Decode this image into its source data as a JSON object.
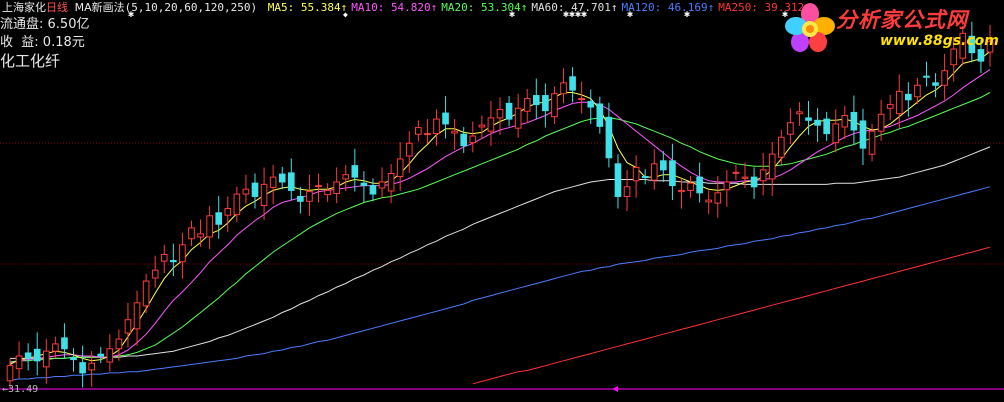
{
  "header": {
    "stock_name": "上海家化",
    "period": "日线",
    "indicator": "MA新画法",
    "params": "(5,10,20,60,120,250)",
    "ma": [
      {
        "label": "MA5:",
        "value": "55.384",
        "arrow": "↑",
        "color": "#ffff55"
      },
      {
        "label": "MA10:",
        "value": "54.820",
        "arrow": "↑",
        "color": "#ff55ff"
      },
      {
        "label": "MA20:",
        "value": "53.304",
        "arrow": "↑",
        "color": "#55ff55"
      },
      {
        "label": "MA60:",
        "value": "47.701",
        "arrow": "↑",
        "color": "#e0e0e0"
      },
      {
        "label": "MA120:",
        "value": "46.169",
        "arrow": "↑",
        "color": "#4a7cff"
      },
      {
        "label": "MA250:",
        "value": "39.312",
        "arrow": "↑",
        "color": "#ff3333"
      }
    ]
  },
  "info": {
    "float_label": "流通盘:",
    "float_value": "6.50亿",
    "eps_label": "收  益:",
    "eps_value": "0.18元",
    "industry": "化工化纤"
  },
  "logo": {
    "text": "分析家公式网",
    "url": "www.88gs.com"
  },
  "colors": {
    "up": "#ff3b3b",
    "down": "#3fe0e8",
    "ma5": "#ffff55",
    "ma10": "#ff55ff",
    "ma20": "#55ff55",
    "ma60": "#e0e0e0",
    "ma120": "#4a7cff",
    "ma250": "#ff3333",
    "grid": "#8b0000",
    "bottom_axis": "#ff00ff"
  },
  "chart_data": {
    "type": "candlestick",
    "low_label": "31.49",
    "ylim": [
      30.8,
      61
    ],
    "close": [
      32.4,
      33.2,
      33.0,
      32.8,
      33.6,
      34.2,
      33.8,
      32.9,
      31.8,
      32.6,
      33.2,
      33.8,
      34.6,
      36.2,
      37.6,
      39.4,
      40.3,
      41.6,
      41.0,
      42.4,
      43.8,
      43.3,
      44.8,
      44.1,
      45.4,
      46.6,
      47.0,
      46.4,
      47.4,
      48.0,
      47.6,
      46.9,
      46.0,
      46.8,
      47.3,
      46.9,
      47.6,
      48.2,
      48.0,
      47.3,
      46.6,
      47.6,
      48.3,
      49.5,
      50.8,
      52.1,
      51.6,
      52.8,
      52.4,
      51.8,
      50.6,
      51.4,
      52.3,
      52.9,
      53.6,
      52.8,
      53.7,
      54.5,
      54.0,
      53.5,
      54.9,
      55.8,
      55.2,
      54.5,
      53.8,
      52.2,
      49.6,
      46.4,
      47.2,
      48.8,
      48.0,
      49.1,
      48.6,
      47.3,
      46.9,
      47.5,
      46.7,
      46.1,
      46.7,
      47.6,
      48.4,
      48.0,
      47.2,
      48.6,
      49.9,
      51.3,
      52.5,
      53.4,
      52.7,
      52.3,
      51.6,
      52.4,
      53.1,
      51.9,
      50.4,
      51.8,
      53.2,
      54.0,
      55.1,
      54.4,
      55.6,
      56.3,
      55.6,
      56.8,
      58.6,
      59.9,
      58.3,
      57.6,
      59.2
    ],
    "ma5": [
      32.5,
      32.9,
      33.0,
      33.2,
      33.4,
      33.6,
      33.5,
      33.3,
      33.0,
      32.8,
      32.9,
      33.2,
      33.7,
      34.8,
      35.9,
      37.1,
      38.4,
      39.6,
      40.5,
      41.1,
      42.0,
      42.6,
      43.3,
      43.6,
      44.2,
      45.0,
      45.6,
      46.0,
      46.5,
      46.9,
      47.1,
      47.2,
      47.0,
      46.9,
      47.0,
      47.0,
      47.2,
      47.6,
      47.8,
      47.7,
      47.5,
      47.5,
      47.7,
      48.3,
      49.1,
      50.0,
      50.7,
      51.5,
      52.0,
      52.0,
      51.7,
      51.6,
      51.7,
      52.2,
      52.6,
      52.9,
      53.3,
      53.8,
      54.1,
      54.2,
      54.6,
      55.0,
      55.0,
      54.8,
      54.5,
      53.6,
      52.2,
      50.4,
      49.2,
      48.8,
      48.0,
      48.0,
      48.2,
      48.2,
      47.9,
      47.6,
      47.3,
      47.0,
      46.9,
      47.0,
      47.3,
      47.6,
      47.7,
      48.0,
      48.6,
      49.5,
      50.5,
      51.4,
      52.2,
      52.6,
      52.7,
      52.7,
      52.8,
      52.6,
      52.2,
      51.9,
      52.0,
      52.4,
      53.0,
      53.6,
      54.2,
      54.8,
      55.2,
      55.8,
      56.6,
      57.4,
      57.6,
      57.8,
      58.4
    ],
    "ma10": [
      32.6,
      32.8,
      32.9,
      33.0,
      33.1,
      33.2,
      33.3,
      33.3,
      33.2,
      33.2,
      33.1,
      33.1,
      33.3,
      33.7,
      34.3,
      35.0,
      35.9,
      36.9,
      37.8,
      38.5,
      39.3,
      40.1,
      41.0,
      41.7,
      42.4,
      43.2,
      43.8,
      44.4,
      44.9,
      45.5,
      45.9,
      46.1,
      46.3,
      46.5,
      46.8,
      46.9,
      47.0,
      47.1,
      47.2,
      47.3,
      47.3,
      47.3,
      47.4,
      47.6,
      47.9,
      48.3,
      48.7,
      49.2,
      49.7,
      50.1,
      50.5,
      50.8,
      51.2,
      51.6,
      51.9,
      52.1,
      52.3,
      52.5,
      52.8,
      53.1,
      53.5,
      53.8,
      54.1,
      54.2,
      54.2,
      54.0,
      53.6,
      53.0,
      52.4,
      51.8,
      51.2,
      50.6,
      50.0,
      49.4,
      48.9,
      48.4,
      48.0,
      47.7,
      47.6,
      47.6,
      47.6,
      47.7,
      47.7,
      47.8,
      47.9,
      48.2,
      48.6,
      49.1,
      49.6,
      50.1,
      50.5,
      50.9,
      51.3,
      51.6,
      51.8,
      51.9,
      52.0,
      52.2,
      52.5,
      52.8,
      53.1,
      53.5,
      53.9,
      54.3,
      54.8,
      55.4,
      55.9,
      56.4,
      56.9
    ],
    "ma20": [
      32.7,
      32.8,
      32.8,
      32.9,
      32.9,
      33.0,
      33.0,
      33.1,
      33.1,
      33.1,
      33.1,
      33.1,
      33.2,
      33.3,
      33.5,
      33.8,
      34.1,
      34.6,
      35.1,
      35.6,
      36.2,
      36.8,
      37.4,
      38.0,
      38.7,
      39.3,
      40.0,
      40.6,
      41.2,
      41.8,
      42.3,
      42.8,
      43.3,
      43.8,
      44.2,
      44.6,
      45.0,
      45.3,
      45.6,
      45.9,
      46.1,
      46.3,
      46.4,
      46.6,
      46.8,
      47.0,
      47.3,
      47.6,
      47.9,
      48.2,
      48.5,
      48.8,
      49.1,
      49.4,
      49.7,
      50.0,
      50.3,
      50.7,
      51.0,
      51.4,
      51.7,
      52.0,
      52.3,
      52.6,
      52.8,
      52.9,
      52.9,
      52.8,
      52.6,
      52.4,
      52.1,
      51.8,
      51.5,
      51.2,
      50.8,
      50.5,
      50.1,
      49.8,
      49.5,
      49.3,
      49.1,
      49.0,
      48.9,
      48.9,
      48.9,
      49.0,
      49.1,
      49.3,
      49.5,
      49.7,
      49.9,
      50.2,
      50.5,
      50.7,
      51.0,
      51.2,
      51.5,
      51.7,
      52.0,
      52.2,
      52.5,
      52.8,
      53.1,
      53.4,
      53.7,
      54.0,
      54.3,
      54.6,
      55.0
    ],
    "ma60": [
      33.0,
      33.0,
      33.0,
      33.0,
      33.0,
      33.0,
      33.0,
      33.1,
      33.1,
      33.1,
      33.1,
      33.1,
      33.1,
      33.2,
      33.2,
      33.3,
      33.4,
      33.5,
      33.6,
      33.8,
      34.0,
      34.2,
      34.4,
      34.7,
      34.9,
      35.2,
      35.5,
      35.8,
      36.1,
      36.4,
      36.8,
      37.1,
      37.5,
      37.8,
      38.2,
      38.5,
      38.9,
      39.2,
      39.6,
      39.9,
      40.3,
      40.6,
      41.0,
      41.3,
      41.7,
      42.0,
      42.4,
      42.7,
      43.1,
      43.4,
      43.7,
      44.1,
      44.4,
      44.7,
      45.0,
      45.3,
      45.6,
      45.9,
      46.2,
      46.5,
      46.8,
      47.0,
      47.2,
      47.4,
      47.6,
      47.7,
      47.8,
      47.8,
      47.8,
      47.8,
      47.8,
      47.7,
      47.7,
      47.7,
      47.6,
      47.6,
      47.6,
      47.5,
      47.5,
      47.5,
      47.5,
      47.4,
      47.4,
      47.4,
      47.4,
      47.4,
      47.4,
      47.4,
      47.4,
      47.4,
      47.4,
      47.5,
      47.5,
      47.5,
      47.6,
      47.7,
      47.8,
      47.9,
      48.0,
      48.2,
      48.4,
      48.6,
      48.8,
      49.0,
      49.3,
      49.6,
      49.9,
      50.2,
      50.5
    ],
    "ma120": [
      31.2,
      31.3,
      31.3,
      31.4,
      31.4,
      31.5,
      31.5,
      31.6,
      31.6,
      31.7,
      31.7,
      31.8,
      31.8,
      31.9,
      31.9,
      32.0,
      32.1,
      32.2,
      32.3,
      32.4,
      32.5,
      32.6,
      32.7,
      32.8,
      32.9,
      33.0,
      33.2,
      33.3,
      33.4,
      33.6,
      33.7,
      33.9,
      34.0,
      34.2,
      34.4,
      34.5,
      34.7,
      34.9,
      35.1,
      35.3,
      35.5,
      35.7,
      35.9,
      36.1,
      36.3,
      36.5,
      36.7,
      36.9,
      37.1,
      37.3,
      37.5,
      37.8,
      38.0,
      38.2,
      38.4,
      38.6,
      38.8,
      39.0,
      39.2,
      39.4,
      39.6,
      39.8,
      40.0,
      40.2,
      40.3,
      40.5,
      40.6,
      40.8,
      40.9,
      41.0,
      41.1,
      41.3,
      41.4,
      41.5,
      41.6,
      41.8,
      41.9,
      42.0,
      42.1,
      42.3,
      42.4,
      42.5,
      42.7,
      42.8,
      42.9,
      43.1,
      43.2,
      43.4,
      43.5,
      43.7,
      43.8,
      44.0,
      44.1,
      44.3,
      44.5,
      44.6,
      44.8,
      45.0,
      45.2,
      45.4,
      45.6,
      45.8,
      46.0,
      46.2,
      46.4,
      46.6,
      46.8,
      47.0,
      47.2
    ],
    "ma250": [
      null,
      null,
      null,
      null,
      null,
      null,
      null,
      null,
      null,
      null,
      null,
      null,
      null,
      null,
      null,
      null,
      null,
      null,
      null,
      null,
      null,
      null,
      null,
      null,
      null,
      null,
      null,
      null,
      null,
      null,
      null,
      null,
      null,
      null,
      null,
      null,
      null,
      null,
      null,
      null,
      null,
      null,
      null,
      null,
      null,
      null,
      null,
      null,
      null,
      null,
      null,
      30.9,
      31.1,
      31.3,
      31.5,
      31.7,
      31.9,
      32.0,
      32.2,
      32.4,
      32.6,
      32.8,
      33.0,
      33.2,
      33.4,
      33.6,
      33.8,
      34.0,
      34.2,
      34.4,
      34.6,
      34.8,
      35.0,
      35.2,
      35.4,
      35.6,
      35.8,
      36.0,
      36.2,
      36.4,
      36.6,
      36.8,
      37.0,
      37.2,
      37.4,
      37.6,
      37.8,
      38.0,
      38.2,
      38.4,
      38.6,
      38.8,
      39.0,
      39.2,
      39.4,
      39.6,
      39.8,
      40.0,
      40.2,
      40.4,
      40.6,
      40.8,
      41.0,
      41.2,
      41.4,
      41.6,
      41.8,
      42.0,
      42.2
    ]
  }
}
